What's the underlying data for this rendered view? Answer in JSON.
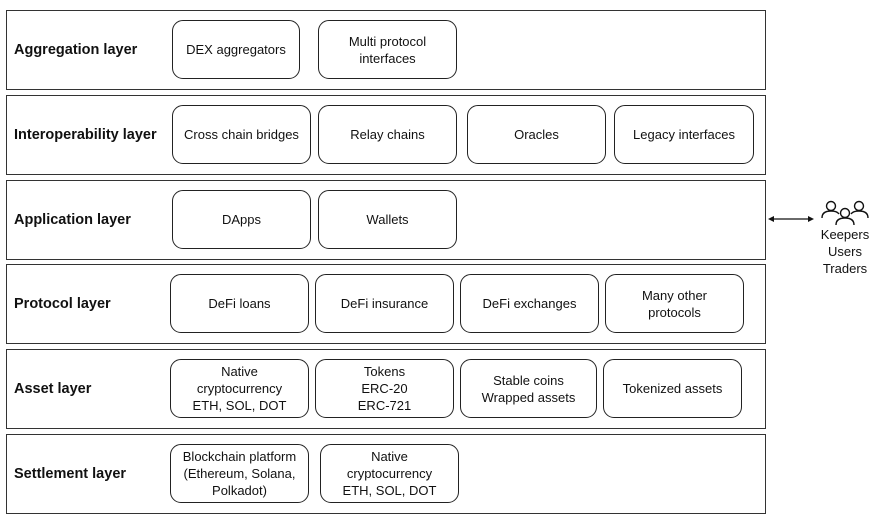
{
  "layers": [
    {
      "label": "Aggregation layer",
      "items": [
        "DEX aggregators",
        "Multi protocol\ninterfaces"
      ]
    },
    {
      "label": "Interoperability layer",
      "items": [
        "Cross chain bridges",
        "Relay chains",
        "Oracles",
        "Legacy interfaces"
      ]
    },
    {
      "label": "Application layer",
      "items": [
        "DApps",
        "Wallets"
      ]
    },
    {
      "label": "Protocol layer",
      "items": [
        "DeFi loans",
        "DeFi insurance",
        "DeFi exchanges",
        "Many other\nprotocols"
      ]
    },
    {
      "label": "Asset layer",
      "items": [
        "Native\ncryptocurrency\nETH, SOL, DOT",
        "Tokens\nERC-20\nERC-721",
        "Stable coins\nWrapped assets",
        "Tokenized assets"
      ]
    },
    {
      "label": "Settlement layer",
      "items": [
        "Blockchain platform\n(Ethereum, Solana,\nPolkadot)",
        "Native\ncryptocurrency\nETH, SOL, DOT"
      ]
    }
  ],
  "actors": {
    "icon": "users-group-icon",
    "label": "Keepers\nUsers\nTraders"
  },
  "connector": {
    "icon": "double-arrow-icon"
  }
}
